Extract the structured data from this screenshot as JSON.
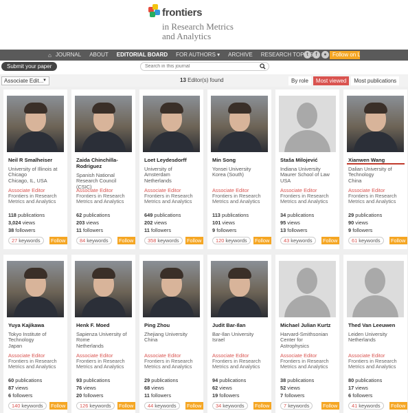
{
  "brand": {
    "name": "frontiers",
    "subtitle_line1": "in Research Metrics",
    "subtitle_line2": "and Analytics",
    "colors": [
      "#e74c3c",
      "#f1c40f",
      "#3498db",
      "#27ae60"
    ]
  },
  "nav": {
    "items": [
      {
        "label": "JOURNAL",
        "icon": "home-icon"
      },
      {
        "label": "ABOUT"
      },
      {
        "label": "EDITORIAL BOARD",
        "active": true
      },
      {
        "label": "FOR AUTHORS ▾"
      },
      {
        "label": "ARCHIVE"
      },
      {
        "label": "RESEARCH TOPICS"
      }
    ],
    "follow_label": "Follow on Li"
  },
  "toolbar": {
    "submit_label": "Submit your paper",
    "search_placeholder": "Search in this journal"
  },
  "filter": {
    "role_selected": "Associate Edit...",
    "count": "13",
    "count_suffix": " Editor(s) found",
    "sort": [
      "By role",
      "Most viewed",
      "Most publications"
    ]
  },
  "editors": [
    {
      "name": "Neil R Smalheiser",
      "affil": [
        "University of Illinois at",
        "Chicago",
        "Chicago, IL, USA"
      ],
      "role": "Associate Editor",
      "journal": [
        "Frontiers in Research",
        "Metrics and Analytics"
      ],
      "pubs": "118",
      "views": "3,024",
      "followers": "38",
      "keywords": "27",
      "photo": "real"
    },
    {
      "name": "Zaida Chinchilla-Rodriguez",
      "affil": [
        "Spanish National",
        "Research Council",
        "(CSIC)"
      ],
      "role": "Associate Editor",
      "journal": [
        "Frontiers in Research",
        "Metrics and Analytics"
      ],
      "pubs": "62",
      "views": "203",
      "followers": "11",
      "keywords": "84",
      "photo": "real"
    },
    {
      "name": "Loet Leydesdorff",
      "affil": [
        "University of",
        "Amsterdam",
        "Netherlands"
      ],
      "role": "Associate Editor",
      "journal": [
        "Frontiers in Research",
        "Metrics and Analytics"
      ],
      "pubs": "649",
      "views": "202",
      "followers": "11",
      "keywords": "358",
      "photo": "real"
    },
    {
      "name": "Min Song",
      "affil": [
        "Yonsei University",
        "Korea (South)"
      ],
      "role": "Associate Editor",
      "journal": [
        "Frontiers in Research",
        "Metrics and Analytics"
      ],
      "pubs": "113",
      "views": "101",
      "followers": "9",
      "keywords": "120",
      "photo": "real"
    },
    {
      "name": "Staša Milojević",
      "affil": [
        "Indiana University",
        "Maurer School of Law",
        "USA"
      ],
      "role": "Associate Editor",
      "journal": [
        "Frontiers in Research",
        "Metrics and Analytics"
      ],
      "pubs": "34",
      "views": "95",
      "followers": "13",
      "keywords": "43",
      "photo": "none"
    },
    {
      "name": "Xianwen Wang",
      "affil": [
        "Dalian University of",
        "Technology",
        "China"
      ],
      "role": "Associate Editor",
      "journal": [
        "Frontiers in Research",
        "Metrics and Analytics"
      ],
      "pubs": "29",
      "views": "90",
      "followers": "9",
      "keywords": "61",
      "photo": "real"
    },
    {
      "name": "Yuya Kajikawa",
      "affil": [
        "Tokyo Institute of",
        "Technology",
        "Japan"
      ],
      "role": "Associate Editor",
      "journal": [
        "Frontiers in Research",
        "Metrics and Analytics"
      ],
      "pubs": "60",
      "views": "87",
      "followers": "6",
      "keywords": "140",
      "photo": "real"
    },
    {
      "name": "Henk F. Moed",
      "affil": [
        "Sapienza University of",
        "Rome",
        "Netherlands"
      ],
      "role": "Associate Editor",
      "journal": [
        "Frontiers in Research",
        "Metrics and Analytics"
      ],
      "pubs": "93",
      "views": "76",
      "followers": "20",
      "keywords": "126",
      "photo": "real"
    },
    {
      "name": "Ping Zhou",
      "affil": [
        "Zhejiang University",
        "China"
      ],
      "role": "Associate Editor",
      "journal": [
        "Frontiers in Research",
        "Metrics and Analytics"
      ],
      "pubs": "29",
      "views": "68",
      "followers": "11",
      "keywords": "44",
      "photo": "real"
    },
    {
      "name": "Judit Bar-Ilan",
      "affil": [
        "Bar-Ilan University",
        "Israel"
      ],
      "role": "Associate Editor",
      "journal": [
        "Frontiers in Research",
        "Metrics and Analytics"
      ],
      "pubs": "94",
      "views": "62",
      "followers": "19",
      "keywords": "34",
      "photo": "real"
    },
    {
      "name": "Michael Julian Kurtz",
      "affil": [
        "Harvard-Smithsonian",
        "Center for",
        "Astrophysics"
      ],
      "role": "Associate Editor",
      "journal": [
        "Frontiers in Research",
        "Metrics and Analytics"
      ],
      "pubs": "38",
      "views": "52",
      "followers": "7",
      "keywords": "7",
      "photo": "none"
    },
    {
      "name": "Thed Van Leeuwen",
      "affil": [
        "Leiden University",
        "Netherlands"
      ],
      "role": "Associate Editor",
      "journal": [
        "Frontiers in Research",
        "Metrics and Analytics"
      ],
      "pubs": "80",
      "views": "17",
      "followers": "6",
      "keywords": "41",
      "photo": "none"
    }
  ],
  "labels": {
    "publications": "publications",
    "views": "views",
    "followers": "followers",
    "keywords": "keywords",
    "follow": "Follow"
  }
}
